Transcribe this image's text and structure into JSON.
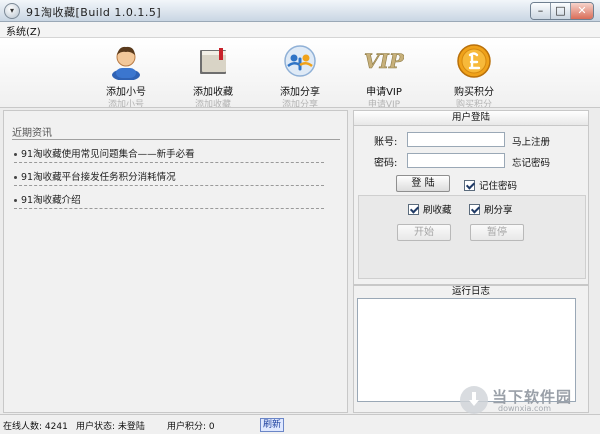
{
  "window": {
    "title": "91淘收藏[Build   1.0.1.5]",
    "menu_glyph": "▾",
    "minimize": "–",
    "maximize": "□",
    "close": "✕"
  },
  "menu": {
    "system": "系统(Z)"
  },
  "toolbar": [
    {
      "label": "添加小号",
      "ghost": "添加小号",
      "icon": "user-icon"
    },
    {
      "label": "添加收藏",
      "ghost": "添加收藏",
      "icon": "book-icon"
    },
    {
      "label": "添加分享",
      "ghost": "添加分享",
      "icon": "share-icon"
    },
    {
      "label": "申请VIP",
      "ghost": "申请VIP",
      "icon": "vip-icon"
    },
    {
      "label": "购买积分",
      "ghost": "购买积分",
      "icon": "coin-icon"
    }
  ],
  "vip_text": "VIP",
  "news": {
    "heading": "近期资讯",
    "items": [
      "91淘收藏使用常见问题集合——新手必看",
      "91淘收藏平台接发任务积分消耗情况",
      "91淘收藏介绍"
    ]
  },
  "login": {
    "title": "用户登陆",
    "account_label": "账号:",
    "password_label": "密码:",
    "account_value": "",
    "password_value": "",
    "register_link": "马上注册",
    "forgot_link": "忘记密码",
    "login_button": "登 陆",
    "remember_label": "记住密码",
    "refresh_collect_label": "刷收藏",
    "refresh_share_label": "刷分享",
    "start_button": "开始",
    "pause_button": "暂停"
  },
  "log": {
    "title": "运行日志"
  },
  "status": {
    "online": "在线人数: 4241",
    "user_state": "用户状态: 未登陆",
    "user_points": "用户积分: 0",
    "refresh": "刷新"
  },
  "watermark": {
    "text": "当下软件园",
    "url": "downxia.com"
  },
  "colors": {
    "accent_blue": "#1b3f9e",
    "coin_orange": "#f0a21a",
    "title_gradient_bottom": "#c9d6e3"
  }
}
